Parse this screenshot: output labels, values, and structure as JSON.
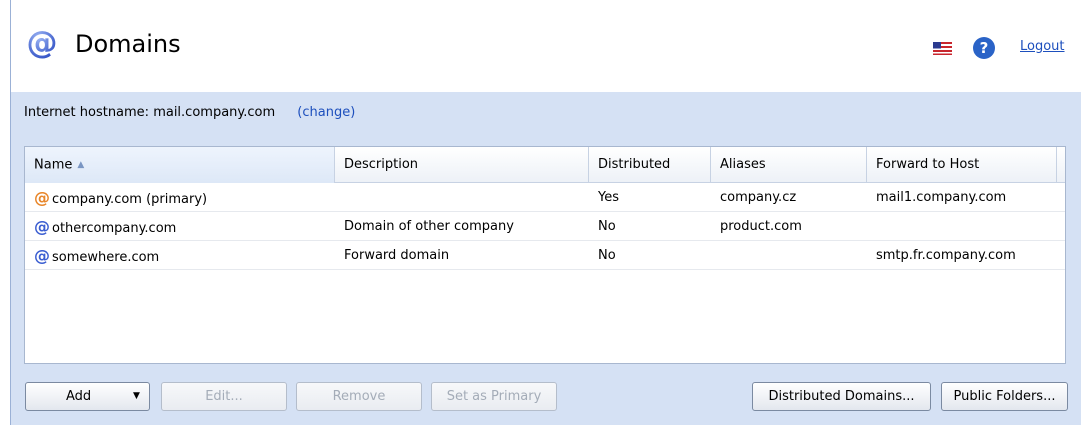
{
  "header": {
    "title": "Domains",
    "logout_label": "Logout",
    "help_glyph": "?"
  },
  "hostname": {
    "label": "Internet hostname: mail.company.com",
    "change_label": "(change)"
  },
  "grid": {
    "columns": [
      "Name",
      "Description",
      "Distributed",
      "Aliases",
      "Forward to Host"
    ],
    "sort_column": "Name",
    "sort_direction": "ascending",
    "rows": [
      {
        "icon": "at-primary-icon",
        "name": "company.com (primary)",
        "description": "",
        "distributed": "Yes",
        "aliases": "company.cz",
        "forward": "mail1.company.com"
      },
      {
        "icon": "at-icon",
        "name": "othercompany.com",
        "description": "Domain of other company",
        "distributed": "No",
        "aliases": "product.com",
        "forward": ""
      },
      {
        "icon": "at-icon",
        "name": "somewhere.com",
        "description": "Forward domain",
        "distributed": "No",
        "aliases": "",
        "forward": "smtp.fr.company.com"
      }
    ]
  },
  "buttons": {
    "add": "Add",
    "edit": "Edit...",
    "remove": "Remove",
    "set_primary": "Set as Primary",
    "distributed_domains": "Distributed Domains...",
    "public_folders": "Public Folders..."
  },
  "colors": {
    "accent": "#3b5ed1",
    "primary_icon": "#e8862a",
    "panel_bg": "#d5e1f4",
    "link": "#1d4fbd"
  }
}
